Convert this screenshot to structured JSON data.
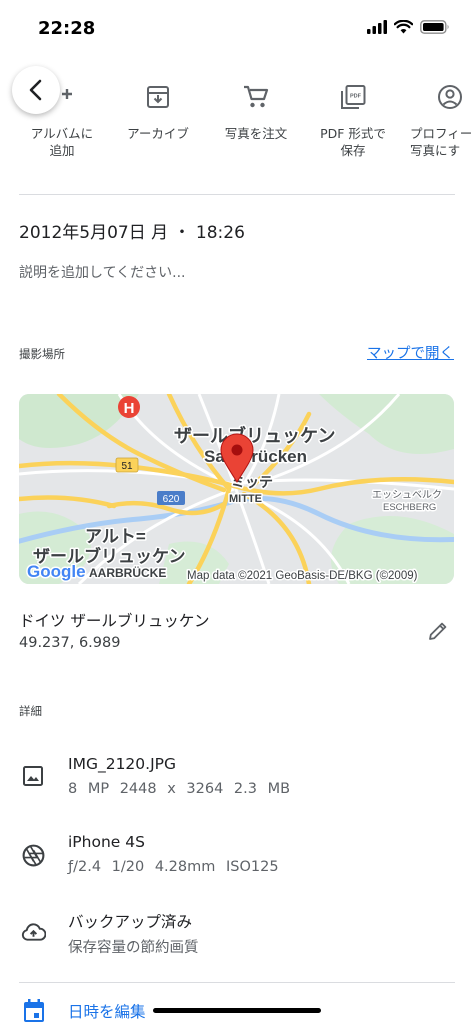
{
  "status": {
    "time": "22:28"
  },
  "actions": [
    {
      "label": "アルバムに\n追加",
      "icon": "add-to-album-icon"
    },
    {
      "label": "アーカイブ",
      "icon": "archive-icon"
    },
    {
      "label": "写真を注文",
      "icon": "cart-icon"
    },
    {
      "label": "PDF 形式で\n保存",
      "icon": "pdf-icon"
    },
    {
      "label": "プロフィー\n写真にす",
      "icon": "account-icon"
    }
  ],
  "photo": {
    "datetime": "2012年5月07日 月 ・ 18:26",
    "description_placeholder": "説明を追加してください..."
  },
  "location": {
    "section_title": "撮影場所",
    "open_map_label": "マップで開く",
    "name": "ドイツ ザールブリュッケン",
    "coords": "49.237, 6.989",
    "map": {
      "city_ja": "ザールブリュッケン",
      "city_de": "Saarbrücken",
      "district_ja": "ミッテ",
      "district_de": "MITTE",
      "alt_label_1": "アルト=",
      "alt_label_2": "ザールブリュッケン",
      "alt_label_3": "AARBRÜCKE",
      "east_ja": "エッシュベルク",
      "east_de": "ESCHBERG",
      "road_51": "51",
      "road_620": "620",
      "hospital": "H",
      "google": "Google",
      "credit": "Map data ©2021 GeoBasis-DE/BKG (©2009)"
    }
  },
  "details": {
    "section_title": "詳細",
    "file": {
      "name": "IMG_2120.JPG",
      "meta": "8 MP 2448 x 3264 2.3 MB"
    },
    "camera": {
      "model": "iPhone 4S",
      "meta": "ƒ/2.4 1/20 4.28mm ISO125"
    },
    "backup": {
      "status": "バックアップ済み",
      "quality": "保存容量の節約画質"
    }
  },
  "footer": {
    "edit_datetime_label": "日時を編集"
  },
  "colors": {
    "accent": "#1a73e8",
    "pin": "#ea4335",
    "road": "#fbd25a"
  }
}
